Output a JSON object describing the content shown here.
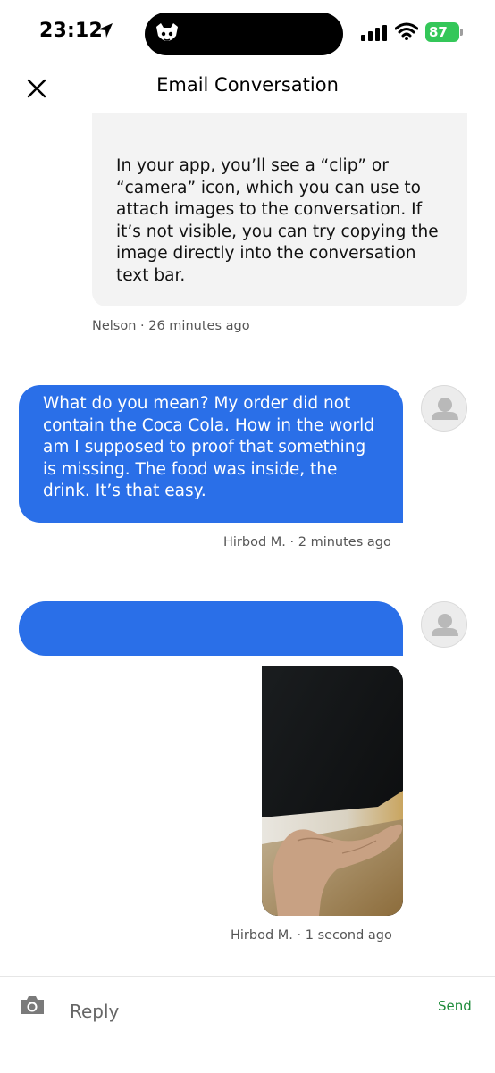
{
  "status_bar": {
    "time": "23:12",
    "battery": "87",
    "icons": [
      "location-arrow-icon",
      "signal-bars-icon",
      "wifi-icon",
      "battery-icon"
    ]
  },
  "header": {
    "title": "Email Conversation",
    "close_icon": "close-icon"
  },
  "messages": [
    {
      "direction": "incoming",
      "text": "In your app, you’ll see a “clip” or “camera” icon, which you can use to attach images to the conversation. If it’s not visible, you can try copying the image directly into the conversation text bar.",
      "meta": "Nelson · 26 minutes ago"
    },
    {
      "direction": "outgoing",
      "text": "What do you mean? My order did not contain the Coca Cola. How in the world am I supposed to proof that something is missing. The food was inside, the drink. It’s that easy.",
      "meta": "Hirbod M. · 2 minutes ago",
      "avatar": "user-placeholder-icon"
    },
    {
      "direction": "outgoing",
      "text": "",
      "attachment": "photo of an open hand",
      "meta": "Hirbod M. · 1 second ago",
      "avatar": "user-placeholder-icon"
    }
  ],
  "composer": {
    "placeholder": "Reply",
    "send_label": "Send",
    "camera_icon": "camera-icon"
  },
  "colors": {
    "outgoing_bubble": "#2a6fe8",
    "incoming_bubble": "#f3f3f3",
    "send": "#1e8b3a",
    "battery": "#34c759"
  }
}
